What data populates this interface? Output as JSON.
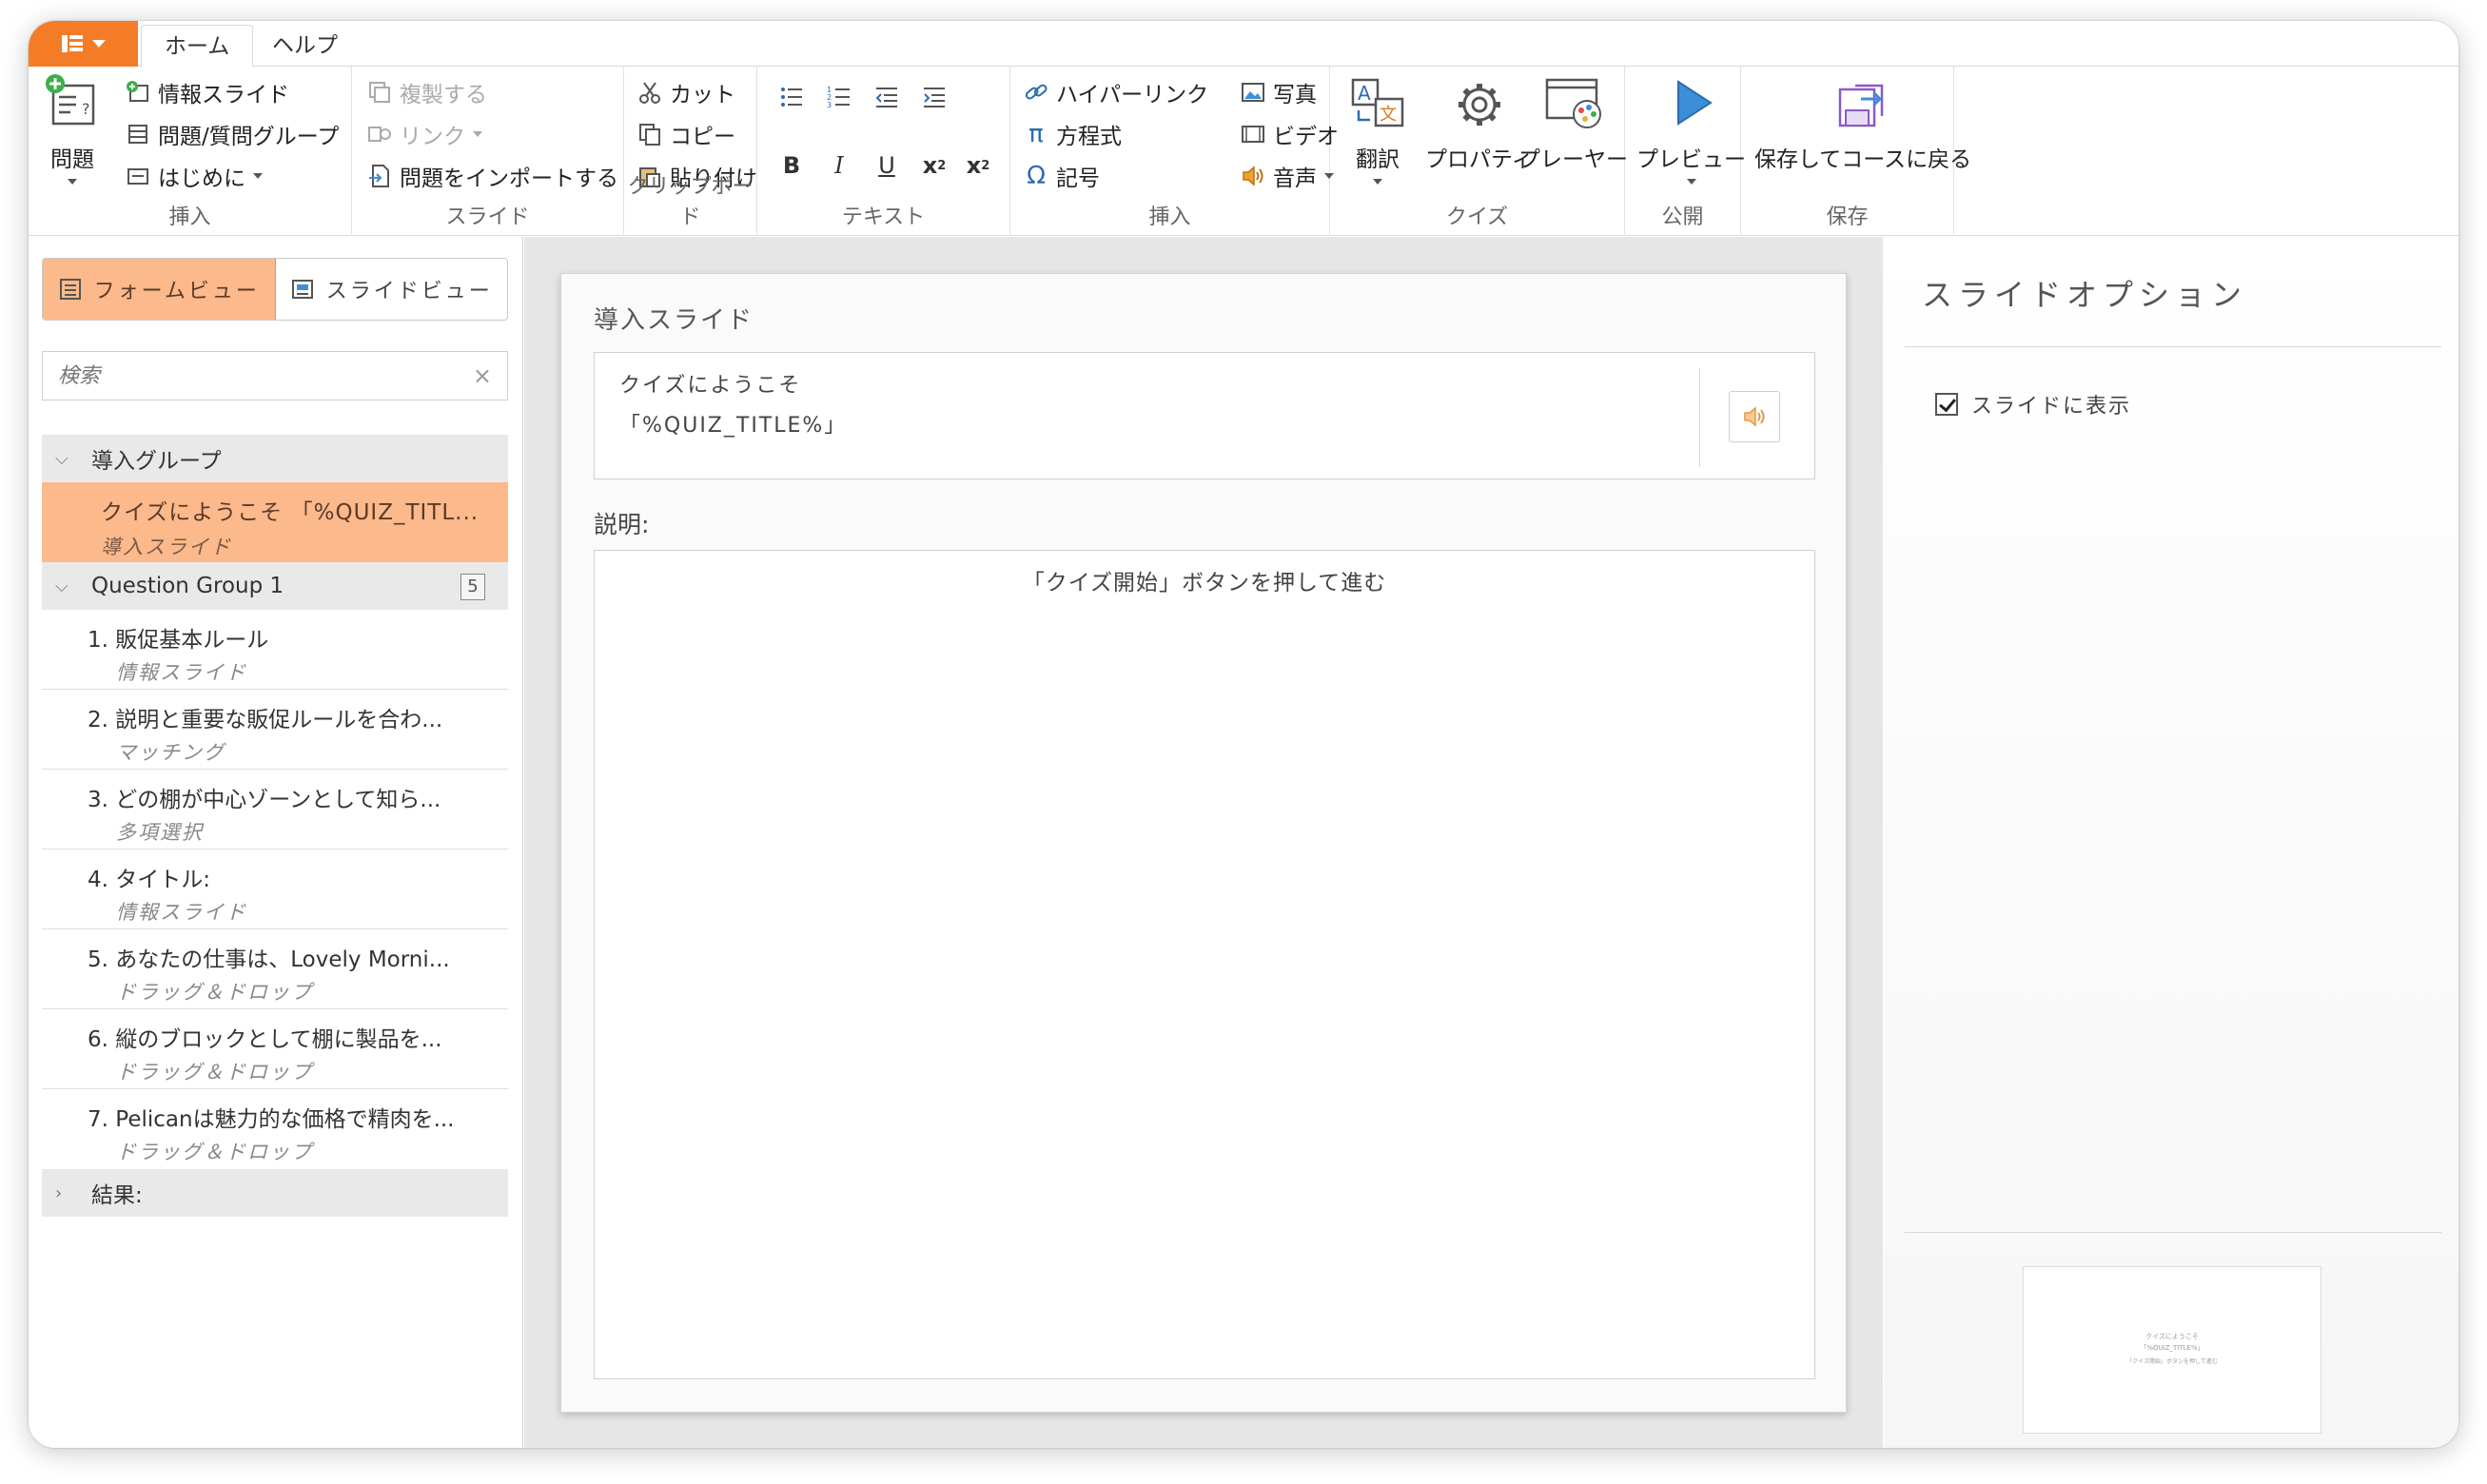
{
  "tabs": [
    "ホーム",
    "ヘルプ"
  ],
  "ribbon": {
    "insert1": {
      "label": "挿入",
      "question": "問題",
      "info_slide": "情報スライド",
      "question_group": "問題/質問グループ",
      "intro": "はじめに"
    },
    "slide": {
      "label": "スライド",
      "duplicate": "複製する",
      "link": "リンク",
      "import": "問題をインポートする"
    },
    "clipboard": {
      "label": "クリップボード",
      "cut": "カット",
      "copy": "コピー",
      "paste": "貼り付け"
    },
    "text": {
      "label": "テキスト",
      "bold": "B",
      "italic": "I",
      "underline": "U",
      "sub": "x",
      "sub_s": "2",
      "sup": "x",
      "sup_s": "2"
    },
    "insert2": {
      "label": "挿入",
      "hyperlink": "ハイパーリンク",
      "equation": "方程式",
      "symbol": "記号",
      "photo": "写真",
      "video": "ビデオ",
      "audio": "音声"
    },
    "quiz": {
      "label": "クイズ",
      "translate": "翻訳",
      "properties": "プロパティ",
      "player": "プレーヤー"
    },
    "publish": {
      "label": "公開",
      "preview": "プレビュー"
    },
    "save": {
      "label": "保存",
      "save_return": "保存してコースに戻る"
    }
  },
  "left": {
    "form_view": "フォームビュー",
    "slide_view": "スライドビュー",
    "search_placeholder": "検索",
    "intro_group": "導入グループ",
    "selected_title": "クイズにようこそ 「%QUIZ_TITL...",
    "selected_type": "導入スライド",
    "question_group": "Question Group 1",
    "question_count": "5",
    "items": [
      {
        "num": "1.",
        "title": "販促基本ルール",
        "type": "情報スライド"
      },
      {
        "num": "2.",
        "title": "説明と重要な販促ルールを合わ...",
        "type": "マッチング"
      },
      {
        "num": "3.",
        "title": "どの棚が中心ゾーンとして知ら...",
        "type": "多項選択"
      },
      {
        "num": "4.",
        "title": "タイトル:",
        "type": "情報スライド"
      },
      {
        "num": "5.",
        "title": "あなたの仕事は、Lovely Morni...",
        "type": "ドラッグ＆ドロップ"
      },
      {
        "num": "6.",
        "title": "縦のブロックとして棚に製品を...",
        "type": "ドラッグ＆ドロップ"
      },
      {
        "num": "7.",
        "title": "Pelicanは魅力的な価格で精肉を...",
        "type": "ドラッグ＆ドロップ"
      }
    ],
    "results": "結果:"
  },
  "editor": {
    "heading": "導入スライド",
    "title_line1": "クイズにようこそ",
    "title_line2": "「%QUIZ_TITLE%」",
    "desc_label": "説明:",
    "desc_text": "「クイズ開始」ボタンを押して進む"
  },
  "right": {
    "title": "スライドオプション",
    "show_slide": "スライドに表示",
    "show_slide_checked": true
  },
  "colors": {
    "accent": "#f47c26",
    "selected": "#fbb98c"
  }
}
